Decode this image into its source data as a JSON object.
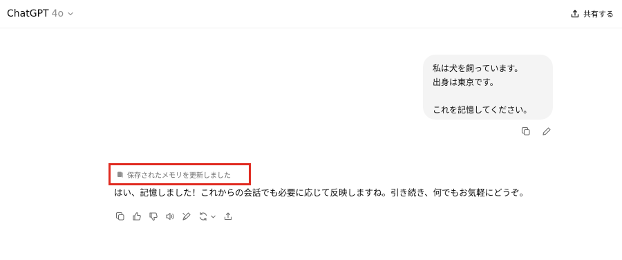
{
  "header": {
    "model_name": "ChatGPT",
    "model_version": "4o",
    "share_label": "共有する"
  },
  "conversation": {
    "user_message": {
      "lines": [
        "私は犬を飼っています。",
        "出身は東京です。",
        "",
        "これを記憶してください。"
      ]
    },
    "memory_note": "保存されたメモリを更新しました",
    "assistant_reply": "はい、記憶しました！これからの会話でも必要に応じて反映しますね。引き続き、何でもお気軽にどうぞ。"
  },
  "icons": {
    "model_chevron": "chevron-down-icon",
    "share": "share-icon",
    "user_copy": "copy-icon",
    "user_edit": "edit-icon",
    "memory": "memory-icon",
    "reply_actions": [
      "copy-icon",
      "thumbs-up-icon",
      "thumbs-down-icon",
      "read-aloud-icon",
      "edit-canvas-icon",
      "regenerate-icon",
      "share-icon"
    ]
  },
  "colors": {
    "bubble_bg": "#f4f4f4",
    "highlight_border": "#e02a20",
    "muted_text": "#8e8e8e"
  }
}
